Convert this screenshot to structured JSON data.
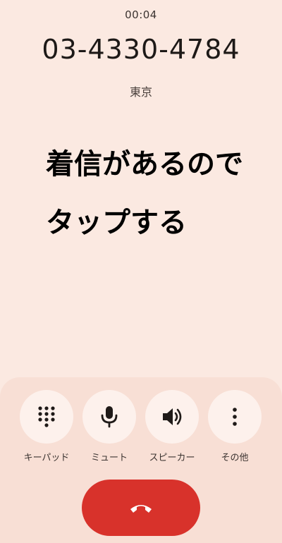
{
  "call": {
    "timer": "00:04",
    "number": "03-4330-4784",
    "location": "東京"
  },
  "annotation": {
    "line1": "着信があるので",
    "line2": "タップする"
  },
  "controls": [
    {
      "label": "キーパッド",
      "icon": "dialpad-icon"
    },
    {
      "label": "ミュート",
      "icon": "microphone-icon"
    },
    {
      "label": "スピーカー",
      "icon": "speaker-icon"
    },
    {
      "label": "その他",
      "icon": "more-vert-icon"
    }
  ],
  "end_call": {
    "icon": "call-end-icon"
  },
  "colors": {
    "background": "#fbe9e1",
    "panel": "#f8dfd5",
    "button": "#fdf1ec",
    "end_call": "#d8322b"
  }
}
